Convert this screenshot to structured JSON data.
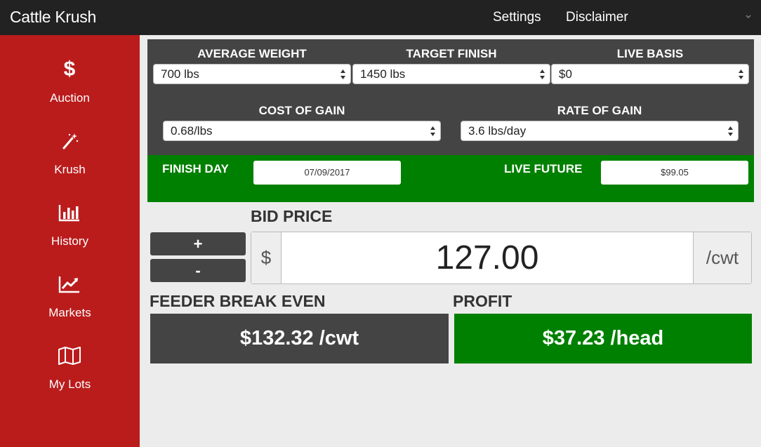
{
  "app": {
    "title": "Cattle Krush"
  },
  "nav": {
    "settings": "Settings",
    "disclaimer": "Disclaimer"
  },
  "sidebar": {
    "items": [
      {
        "label": "Auction",
        "icon": "dollar-icon"
      },
      {
        "label": "Krush",
        "icon": "magic-wand-icon"
      },
      {
        "label": "History",
        "icon": "bar-chart-icon"
      },
      {
        "label": "Markets",
        "icon": "line-chart-icon"
      },
      {
        "label": "My Lots",
        "icon": "map-icon"
      }
    ]
  },
  "inputs": {
    "average_weight": {
      "label": "AVERAGE WEIGHT",
      "value": "700 lbs"
    },
    "target_finish": {
      "label": "TARGET FINISH",
      "value": "1450 lbs"
    },
    "live_basis": {
      "label": "LIVE BASIS",
      "value": "$0"
    },
    "cost_of_gain": {
      "label": "COST OF GAIN",
      "value": "0.68/lbs"
    },
    "rate_of_gain": {
      "label": "RATE OF GAIN",
      "value": "3.6 lbs/day"
    }
  },
  "finish": {
    "finish_day_label": "FINISH DAY",
    "finish_day_value": "07/09/2017",
    "live_future_label": "LIVE FUTURE",
    "live_future_value": "$99.05"
  },
  "bid": {
    "title": "BID PRICE",
    "plus": "+",
    "minus": "-",
    "prefix": "$",
    "value": "127.00",
    "suffix": "/cwt"
  },
  "results": {
    "break_even_label": "FEEDER BREAK EVEN",
    "break_even_value": "$132.32 /cwt",
    "profit_label": "PROFIT",
    "profit_value": "$37.23 /head"
  },
  "colors": {
    "sidebar": "#ba1c1c",
    "topbar": "#222222",
    "panel": "#444444",
    "positive": "#008000"
  }
}
